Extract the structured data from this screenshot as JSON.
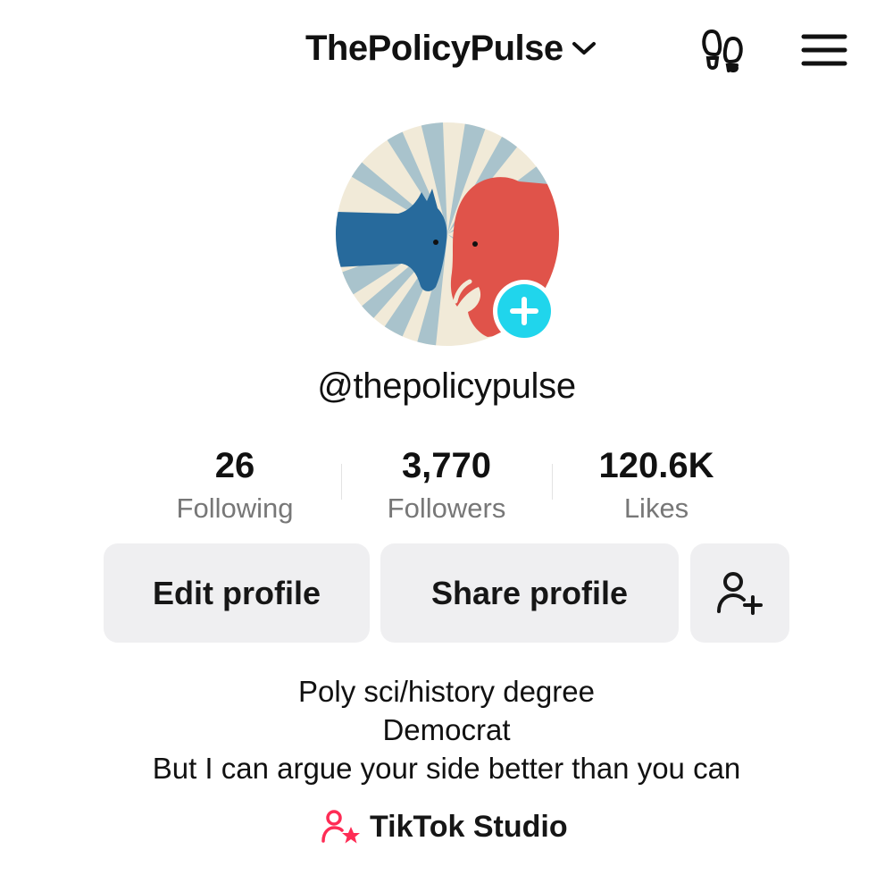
{
  "header": {
    "username": "ThePolicyPulse",
    "dropdown_icon": "chevron-down-icon",
    "footprints_icon": "footprints-icon",
    "menu_icon": "hamburger-menu-icon"
  },
  "profile": {
    "avatar_description_icon": "donkey-vs-elephant-avatar",
    "add_icon": "plus-icon",
    "handle": "@thepolicypulse"
  },
  "stats": [
    {
      "value": "26",
      "label": "Following"
    },
    {
      "value": "3,770",
      "label": "Followers"
    },
    {
      "value": "120.6K",
      "label": "Likes"
    }
  ],
  "buttons": {
    "edit_profile": "Edit profile",
    "share_profile": "Share profile",
    "add_friend_icon": "add-user-icon"
  },
  "bio": [
    "Poly sci/history degree",
    "Democrat",
    "But I can argue your side better than you can"
  ],
  "studio": {
    "label": "TikTok Studio",
    "icon": "user-star-icon"
  },
  "colors": {
    "accent_cyan": "#20d5ec",
    "studio_pink": "#fe2c55",
    "button_bg": "#efeff1",
    "secondary_text": "#777777"
  }
}
